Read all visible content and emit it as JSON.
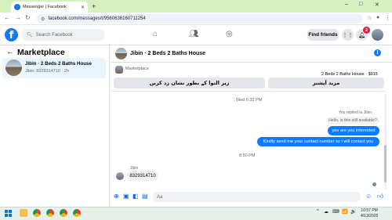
{
  "browser": {
    "tab_title": "Messenger | Facebook",
    "url": "facebook.com/messages/t/9560636160711254",
    "new_tab_icon": "+",
    "window_controls": [
      "–",
      "□",
      "✕"
    ]
  },
  "fb_header": {
    "logo": "f",
    "search_placeholder": "Search Facebook",
    "find_friends_label": "Find friends",
    "notification_count": "2"
  },
  "sidebar": {
    "title": "Marketplace",
    "conversations": [
      {
        "name": "Jibin · 2 Beds 2 Baths House",
        "subtitle": "Jibin: 8329314710 · 2h"
      }
    ]
  },
  "chat": {
    "title": "Jibin · 2 Beds 2 Baths House",
    "marketplace_label": "Marketplace",
    "listing_price": "2 Beds 2 Baths House · $915",
    "action_buttons": [
      "زیر التوا کے بطور نشان زد کریں",
      "مزید آپشنز"
    ],
    "messages": {
      "timestamp_1": "Wed 6:32 PM",
      "replied_note": "You replied to Jibin",
      "quoted_text": "Hello, is this still available?",
      "outgoing_1": "yes are you interested",
      "outgoing_2": "Kindly send me your contact number so i will contact you",
      "timestamp_2": "8:50 PM",
      "sender_name": "Jibin",
      "incoming_1": "8329314710"
    },
    "composer_placeholder": "Aa"
  },
  "taskbar": {
    "time": "10:57 PM",
    "date": "4/13/2025",
    "tray_icons": [
      "^",
      "☁",
      "⌨",
      "📶",
      "🔊"
    ]
  },
  "colors": {
    "facebook_blue": "#1877f2",
    "messenger_blue": "#0a7cff",
    "notification_red": "#e41e3f"
  }
}
